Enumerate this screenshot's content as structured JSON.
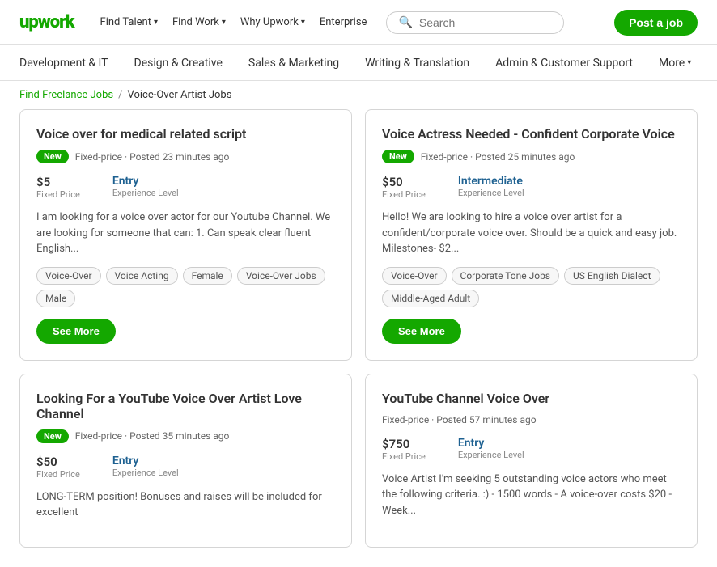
{
  "header": {
    "logo": "upwork",
    "nav": [
      {
        "label": "Find Talent",
        "has_chevron": true
      },
      {
        "label": "Find Work",
        "has_chevron": true
      },
      {
        "label": "Why Upwork",
        "has_chevron": true
      },
      {
        "label": "Enterprise",
        "has_chevron": false
      }
    ],
    "search_placeholder": "Search",
    "post_job_label": "Post a job"
  },
  "secondary_nav": {
    "items": [
      {
        "label": "Development & IT"
      },
      {
        "label": "Design & Creative"
      },
      {
        "label": "Sales & Marketing"
      },
      {
        "label": "Writing & Translation"
      },
      {
        "label": "Admin & Customer Support"
      },
      {
        "label": "More"
      }
    ]
  },
  "breadcrumb": {
    "link_label": "Find Freelance Jobs",
    "separator": "/",
    "current": "Voice-Over Artist Jobs"
  },
  "jobs": [
    {
      "title": "Voice over for medical related script",
      "badge": "New",
      "meta": "Fixed-price · Posted 23 minutes ago",
      "price": "$5",
      "price_label": "Fixed Price",
      "level": "Entry",
      "level_label": "Experience Level",
      "description": "I am looking for a voice over actor for our Youtube Channel. We are looking for someone that can: 1. Can speak clear fluent English...",
      "tags": [
        "Voice-Over",
        "Voice Acting",
        "Female",
        "Voice-Over Jobs",
        "Male"
      ],
      "see_more": "See More"
    },
    {
      "title": "Voice Actress Needed - Confident Corporate Voice",
      "badge": "New",
      "meta": "Fixed-price · Posted 25 minutes ago",
      "price": "$50",
      "price_label": "Fixed Price",
      "level": "Intermediate",
      "level_label": "Experience Level",
      "description": "Hello! We are looking to hire a voice over artist for a confident/corporate voice over. Should be a quick and easy job. Milestones- $2...",
      "tags": [
        "Voice-Over",
        "Corporate Tone Jobs",
        "US English Dialect",
        "Middle-Aged Adult"
      ],
      "see_more": "See More"
    },
    {
      "title": "Looking For a YouTube Voice Over Artist Love Channel",
      "badge": "New",
      "meta": "Fixed-price · Posted 35 minutes ago",
      "price": "$50",
      "price_label": "Fixed Price",
      "level": "Entry",
      "level_label": "Experience Level",
      "description": "LONG-TERM position! Bonuses and raises will be included for excellent",
      "tags": [],
      "see_more": ""
    },
    {
      "title": "YouTube Channel Voice Over",
      "badge": "",
      "meta": "Fixed-price · Posted 57 minutes ago",
      "price": "$750",
      "price_label": "Fixed Price",
      "level": "Entry",
      "level_label": "Experience Level",
      "description": "Voice Artist I'm seeking 5 outstanding voice actors who meet the following criteria. :) - 1500 words - A voice-over costs $20 - Week...",
      "tags": [],
      "see_more": ""
    }
  ]
}
